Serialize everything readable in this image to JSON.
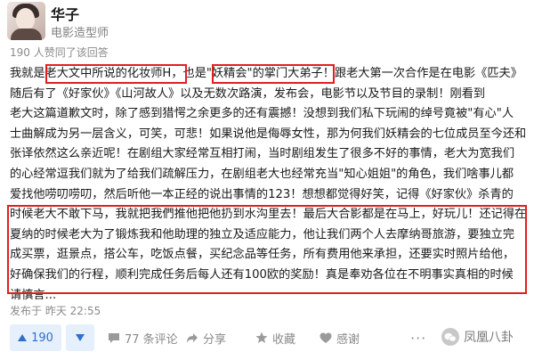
{
  "author": {
    "name": "华子",
    "title": "电影造型师"
  },
  "votes_summary": "190 人赞同了该回答",
  "answer_lines": [
    "我就是老大文中所说的化妆师H，也是\"妖精会\"的掌门大弟子！跟老大第一次合作是在电影《匹夫》",
    "随后有了《好家伙》《山河故人》以及无数次路演，发布会，电影节以及节目的录制！刚看到",
    "老大这篇道歉文时，除了感到猎愕之余更多的还有震撼！没想到我们私下玩闹的绰号竟被\"有心\"人",
    "士曲解成为另一层含义，可笑，可悲！如果说他是侮辱女性，那为何我们妖精会的七位成员至今还和",
    "张译依然这么亲近呢！在剧组大家经常互相打闹，当时剧组发生了很多不好的事情，老大为宽我们",
    "的心经常逗我们就为了给我们疏解压力，在剧组老大也经常充当\"知心姐姐\"的角色，我们啥事儿都",
    "爱找他唠叨唠叨，然后听他一本正经的说出事情的123！想想都觉得好笑，记得《好家伙》杀青的",
    "时候老大不敢下马，我就把我們推他把他扔到水沟里去！最后大合影都是在马上，好玩儿！还记得在",
    "夏纳的时候老大为了锻炼我和他助理的独立及适应能力，他让我们两个人去摩纳哥旅游，要独立完",
    "成买票，逛景点，搭公车，吃饭点餐，买纪念品等任务，所有费用他来承担，还要实时照片给他，",
    "好确保我们的行程，顺利完成任务后每人还有100欧的奖励！真是奉劝各位在不明事实真相的时候",
    "请慎言..."
  ],
  "timestamp": "发布于 昨天 22:55",
  "actions": {
    "vote_count": "190",
    "comments": "77 条评论",
    "share": "分享",
    "favorite": "收藏",
    "thanks": "感谢",
    "more": "···"
  },
  "watermark": "凤凰八卦",
  "colors": {
    "highlight_box": "#e02020",
    "vote_blue": "#2f6fce",
    "vote_bg": "#e5f0fc",
    "meta_gray": "#8a8a8a"
  }
}
